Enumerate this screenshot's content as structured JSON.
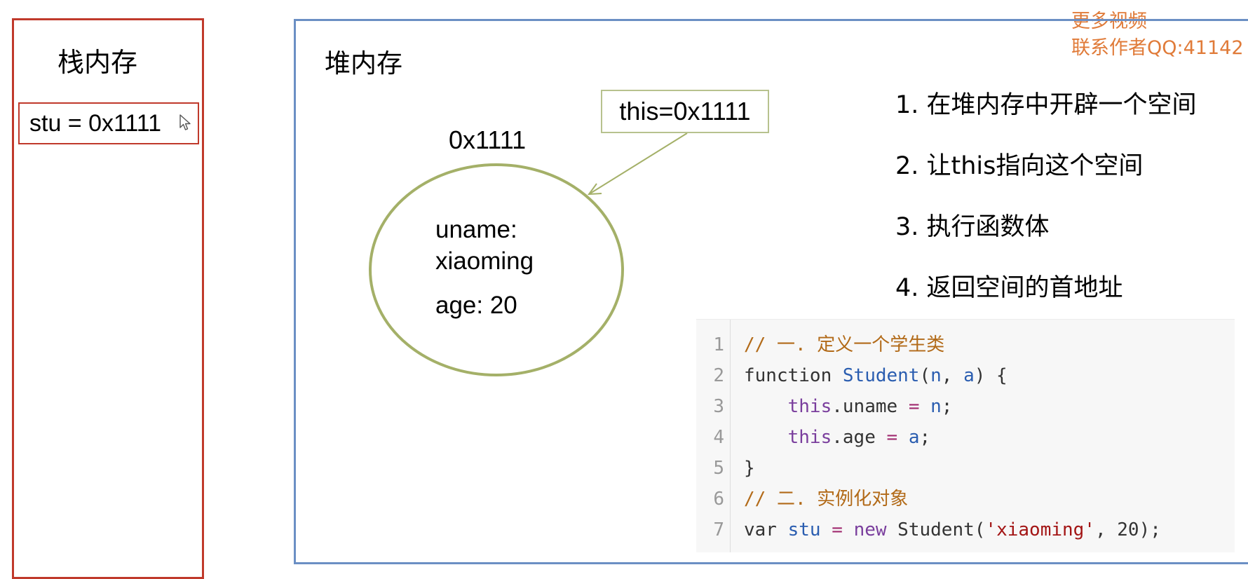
{
  "stack": {
    "title": "栈内存",
    "variable": "stu = 0x1111"
  },
  "heap": {
    "title": "堆内存",
    "this_label": "this=0x1111",
    "object_address": "0x1111",
    "object_fields": {
      "uname_key": "uname:",
      "uname_value": "xiaoming",
      "age": "age: 20"
    }
  },
  "watermark": {
    "line1": "更多视频",
    "line2": "联系作者QQ:41142"
  },
  "steps": [
    "1. 在堆内存中开辟一个空间",
    "2. 让this指向这个空间",
    "3. 执行函数体",
    "4. 返回空间的首地址"
  ],
  "code": {
    "line_numbers": [
      "1",
      "2",
      "3",
      "4",
      "5",
      "6",
      "7"
    ],
    "lines": [
      [
        {
          "t": "comment",
          "v": "// 一. 定义一个学生类"
        }
      ],
      [
        {
          "t": "keyword",
          "v": "function "
        },
        {
          "t": "name",
          "v": "Student"
        },
        {
          "t": "plain",
          "v": "("
        },
        {
          "t": "param",
          "v": "n"
        },
        {
          "t": "plain",
          "v": ", "
        },
        {
          "t": "param",
          "v": "a"
        },
        {
          "t": "plain",
          "v": ") {"
        }
      ],
      [
        {
          "t": "plain",
          "v": "    "
        },
        {
          "t": "keyword2",
          "v": "this"
        },
        {
          "t": "plain",
          "v": ".uname "
        },
        {
          "t": "op",
          "v": "="
        },
        {
          "t": "plain",
          "v": " "
        },
        {
          "t": "param",
          "v": "n"
        },
        {
          "t": "plain",
          "v": ";"
        }
      ],
      [
        {
          "t": "plain",
          "v": "    "
        },
        {
          "t": "keyword2",
          "v": "this"
        },
        {
          "t": "plain",
          "v": ".age "
        },
        {
          "t": "op",
          "v": "="
        },
        {
          "t": "plain",
          "v": " "
        },
        {
          "t": "param",
          "v": "a"
        },
        {
          "t": "plain",
          "v": ";"
        }
      ],
      [
        {
          "t": "plain",
          "v": "}"
        }
      ],
      [
        {
          "t": "comment",
          "v": "// 二. 实例化对象"
        }
      ],
      [
        {
          "t": "keyword",
          "v": "var "
        },
        {
          "t": "name",
          "v": "stu"
        },
        {
          "t": "plain",
          "v": " "
        },
        {
          "t": "op",
          "v": "="
        },
        {
          "t": "plain",
          "v": " "
        },
        {
          "t": "keyword2",
          "v": "new"
        },
        {
          "t": "plain",
          "v": " Student("
        },
        {
          "t": "str",
          "v": "'xiaoming'"
        },
        {
          "t": "plain",
          "v": ", 20);"
        }
      ]
    ]
  },
  "colors": {
    "stack_border": "#c0392b",
    "heap_border": "#6b8fc4",
    "object_ellipse": "#a4b068",
    "this_box_border": "#b7c28e",
    "watermark": "#e07b39"
  },
  "icons": {
    "cursor": "mouse-pointer-icon",
    "pointer_arrow": "arrow-icon"
  }
}
